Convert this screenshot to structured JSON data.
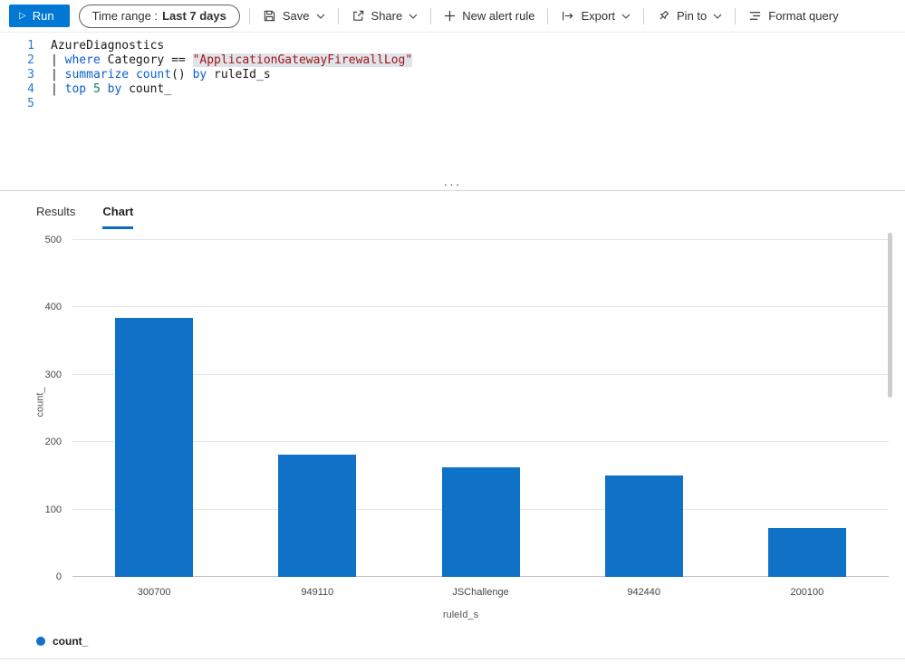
{
  "toolbar": {
    "run_label": "Run",
    "time_range_label": "Time range :",
    "time_range_value": "Last 7 days",
    "save_label": "Save",
    "share_label": "Share",
    "new_alert_label": "New alert rule",
    "export_label": "Export",
    "pin_label": "Pin to",
    "format_label": "Format query"
  },
  "editor": {
    "lines": [
      {
        "num": "1",
        "tokens": [
          {
            "c": "plain",
            "t": "AzureDiagnostics"
          }
        ]
      },
      {
        "num": "2",
        "tokens": [
          {
            "c": "plain",
            "t": "| "
          },
          {
            "c": "kw",
            "t": "where"
          },
          {
            "c": "plain",
            "t": " Category "
          },
          {
            "c": "op",
            "t": "=="
          },
          {
            "c": "plain",
            "t": " "
          },
          {
            "c": "str",
            "t": "\"ApplicationGatewayFirewallLog\""
          }
        ]
      },
      {
        "num": "3",
        "tokens": [
          {
            "c": "plain",
            "t": "| "
          },
          {
            "c": "kw",
            "t": "summarize"
          },
          {
            "c": "plain",
            "t": " "
          },
          {
            "c": "fn",
            "t": "count"
          },
          {
            "c": "plain",
            "t": "() "
          },
          {
            "c": "kw",
            "t": "by"
          },
          {
            "c": "plain",
            "t": " ruleId_s"
          }
        ]
      },
      {
        "num": "4",
        "tokens": [
          {
            "c": "plain",
            "t": "| "
          },
          {
            "c": "kw",
            "t": "top"
          },
          {
            "c": "plain",
            "t": " "
          },
          {
            "c": "num",
            "t": "5"
          },
          {
            "c": "plain",
            "t": " "
          },
          {
            "c": "kw",
            "t": "by"
          },
          {
            "c": "plain",
            "t": " count_"
          }
        ]
      },
      {
        "num": "5",
        "tokens": []
      }
    ]
  },
  "splitter_handle": "···",
  "tabs": [
    {
      "label": "Results",
      "active": false
    },
    {
      "label": "Chart",
      "active": true
    }
  ],
  "chart_data": {
    "type": "bar",
    "title": "",
    "categories": [
      "300700",
      "949110",
      "JSChallenge",
      "942440",
      "200100"
    ],
    "values": [
      385,
      181,
      162,
      151,
      72
    ],
    "xlabel": "ruleId_s",
    "ylabel": "count_",
    "ylim": [
      0,
      500
    ],
    "yticks": [
      0,
      100,
      200,
      300,
      400,
      500
    ],
    "grid": true,
    "bar_color": "#1072c6",
    "legend_position": "bottom-left",
    "legend": [
      {
        "label": "count_",
        "color": "#1072c6"
      }
    ]
  },
  "colors": {
    "accent": "#0078d4",
    "bar": "#1072c6"
  }
}
